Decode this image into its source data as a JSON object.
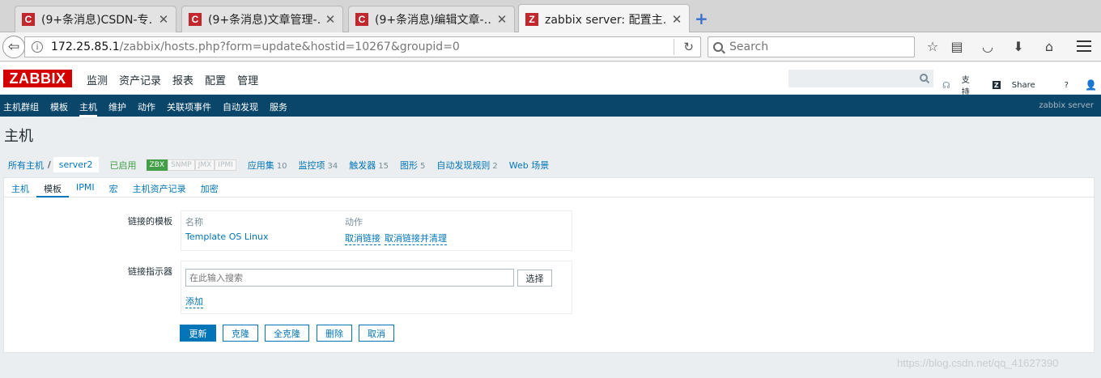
{
  "browser": {
    "tabs": [
      {
        "favicon": "C",
        "title": "(9+条消息)CSDN-专…"
      },
      {
        "favicon": "C",
        "title": "(9+条消息)文章管理-…"
      },
      {
        "favicon": "C",
        "title": "(9+条消息)编辑文章-…"
      },
      {
        "favicon": "Z",
        "title": "zabbix server: 配置主…"
      }
    ],
    "url_host": "172.25.85.1",
    "url_path": "/zabbix/hosts.php?form=update&hostid=10267&groupid=0",
    "search_placeholder": "Search"
  },
  "zabbix": {
    "logo": "ZABBIX",
    "main_menu": [
      "监测",
      "资产记录",
      "报表",
      "配置",
      "管理"
    ],
    "header_links": {
      "support": "支持",
      "share": "Share",
      "help": "?"
    },
    "sub_menu": [
      "主机群组",
      "模板",
      "主机",
      "维护",
      "动作",
      "关联项事件",
      "自动发现",
      "服务"
    ],
    "server_name": "zabbix server"
  },
  "page": {
    "title": "主机",
    "breadcrumb": {
      "all_hosts": "所有主机",
      "separator": "/",
      "current": "server2"
    },
    "status": "已启用",
    "availability": [
      "ZBX",
      "SNMP",
      "JMX",
      "IPMI"
    ],
    "counts": [
      {
        "label": "应用集",
        "num": "10"
      },
      {
        "label": "监控项",
        "num": "34"
      },
      {
        "label": "触发器",
        "num": "15"
      },
      {
        "label": "图形",
        "num": "5"
      },
      {
        "label": "自动发现规则",
        "num": "2"
      },
      {
        "label": "Web 场景",
        "num": ""
      }
    ],
    "form_tabs": [
      "主机",
      "模板",
      "IPMI",
      "宏",
      "主机资产记录",
      "加密"
    ],
    "linked_templates": {
      "label": "链接的模板",
      "col_name": "名称",
      "col_action": "动作",
      "template": "Template OS Linux",
      "unlink": "取消链接",
      "unlink_clear": "取消链接并清理"
    },
    "link_indicator": {
      "label": "链接指示器",
      "placeholder": "在此输入搜索",
      "select": "选择",
      "add": "添加"
    },
    "buttons": {
      "update": "更新",
      "clone": "克隆",
      "full_clone": "全克隆",
      "delete": "删除",
      "cancel": "取消"
    }
  },
  "watermark": "https://blog.csdn.net/qq_41627390",
  "colors": {
    "accent": "#0275b8",
    "nav": "#0a466a",
    "logo": "#d40000",
    "enabled": "#429e47"
  }
}
